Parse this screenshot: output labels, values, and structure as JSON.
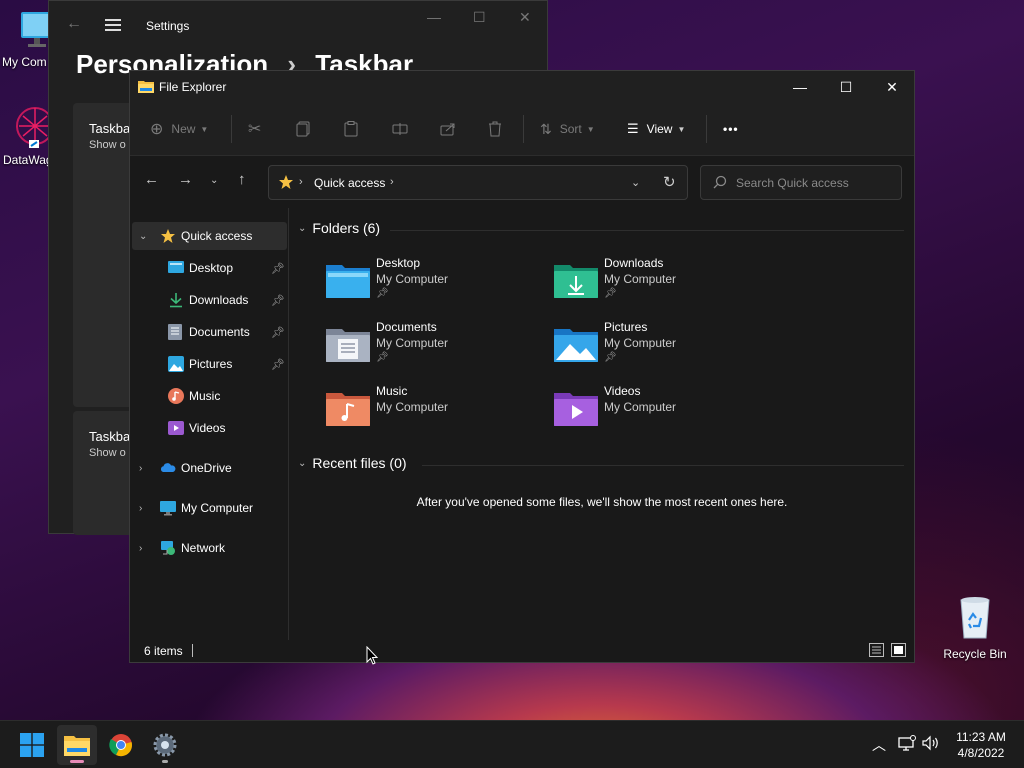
{
  "desktop": {
    "icons": [
      {
        "label": "My Com"
      },
      {
        "label": "DataWag"
      }
    ],
    "recycle_bin": "Recycle Bin"
  },
  "settings": {
    "title": "Settings",
    "breadcrumb_parent": "Personalization",
    "breadcrumb_sep": "›",
    "breadcrumb_current": "Taskbar",
    "cards": [
      {
        "title": "Taskba",
        "sub": "Show o"
      },
      {
        "title": "Taskba",
        "sub": "Show o"
      }
    ]
  },
  "explorer": {
    "title": "File Explorer",
    "toolbar": {
      "new_label": "New",
      "sort_label": "Sort",
      "view_label": "View",
      "more_label": "•••"
    },
    "address": {
      "location": "Quick access"
    },
    "search": {
      "placeholder": "Search Quick access"
    },
    "sidebar": {
      "quick_access": "Quick access",
      "pinned": [
        {
          "label": "Desktop",
          "pinned": true
        },
        {
          "label": "Downloads",
          "pinned": true
        },
        {
          "label": "Documents",
          "pinned": true
        },
        {
          "label": "Pictures",
          "pinned": true
        },
        {
          "label": "Music",
          "pinned": false
        },
        {
          "label": "Videos",
          "pinned": false
        }
      ],
      "onedrive": "OneDrive",
      "my_computer": "My Computer",
      "network": "Network"
    },
    "content": {
      "folders_header": "Folders (6)",
      "folders": [
        {
          "name": "Desktop",
          "location": "My Computer",
          "pinned": true
        },
        {
          "name": "Downloads",
          "location": "My Computer",
          "pinned": true
        },
        {
          "name": "Documents",
          "location": "My Computer",
          "pinned": true
        },
        {
          "name": "Pictures",
          "location": "My Computer",
          "pinned": true
        },
        {
          "name": "Music",
          "location": "My Computer",
          "pinned": false
        },
        {
          "name": "Videos",
          "location": "My Computer",
          "pinned": false
        }
      ],
      "recent_header": "Recent files (0)",
      "recent_empty": "After you've opened some files, we'll show the most recent ones here."
    },
    "status": {
      "item_count": "6 items"
    }
  },
  "taskbar": {
    "time": "11:23 AM",
    "date": "4/8/2022"
  },
  "colors": {
    "accent": "#0078d4",
    "folder_yellow": "#f5c043",
    "indicator_pink": "#e88bb8"
  }
}
